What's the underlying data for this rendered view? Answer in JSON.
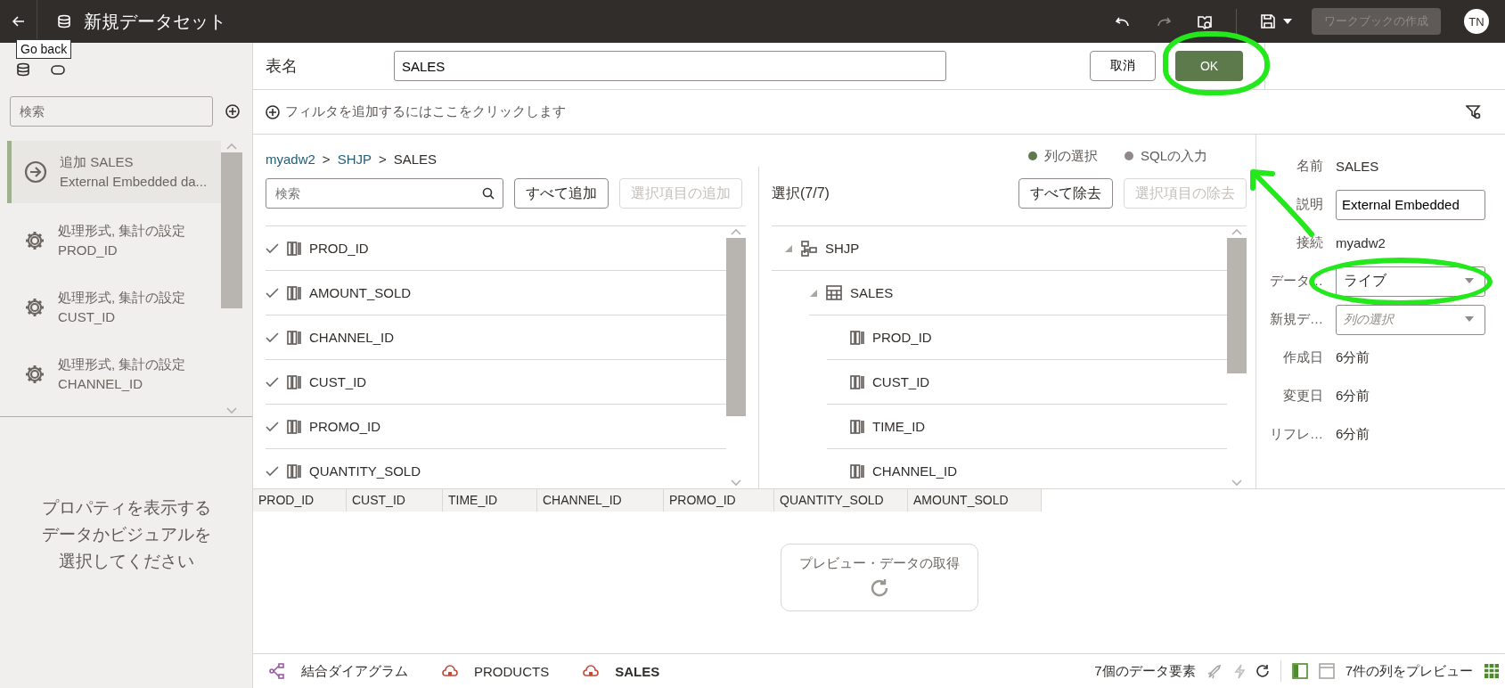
{
  "header": {
    "title": "新規データセット",
    "create_workbook": {
      "label": "ワークブックの作成",
      "disabled": true
    },
    "avatar": "TN"
  },
  "tooltip": "Go back",
  "sidebar": {
    "search": {
      "placeholder": "検索"
    },
    "items": [
      {
        "kind": "add",
        "title": "追加 SALES",
        "subtitle": "External Embedded da...",
        "selected": true
      },
      {
        "kind": "settings",
        "title": "処理形式, 集計の設定",
        "subtitle": "PROD_ID",
        "selected": false
      },
      {
        "kind": "settings",
        "title": "処理形式, 集計の設定",
        "subtitle": "CUST_ID",
        "selected": false
      },
      {
        "kind": "settings",
        "title": "処理形式, 集計の設定",
        "subtitle": "CHANNEL_ID",
        "selected": false
      }
    ],
    "message": "プロパティを表示するデータかビジュアルを選択してください"
  },
  "table_name": {
    "label": "表名",
    "value": "SALES"
  },
  "cancel_button": "取消",
  "ok_button": {
    "label": "OK",
    "annotated": true
  },
  "filter_hint": "フィルタを追加するにはここをクリックします",
  "breadcrumb": {
    "separator": ">",
    "items": [
      {
        "text": "myadw2",
        "link": true
      },
      {
        "text": "SHJP",
        "link": true
      },
      {
        "text": "SALES",
        "link": false
      }
    ]
  },
  "modes": [
    {
      "label": "列の選択",
      "selected": true
    },
    {
      "label": "SQLの入力",
      "selected": false
    }
  ],
  "available": {
    "search": {
      "placeholder": "検索"
    },
    "add_all": "すべて追加",
    "add_selected": {
      "label": "選択項目の追加",
      "disabled": true
    },
    "columns": [
      {
        "name": "PROD_ID",
        "checked": true
      },
      {
        "name": "AMOUNT_SOLD",
        "checked": true
      },
      {
        "name": "CHANNEL_ID",
        "checked": true
      },
      {
        "name": "CUST_ID",
        "checked": true
      },
      {
        "name": "PROMO_ID",
        "checked": true
      },
      {
        "name": "QUANTITY_SOLD",
        "checked": true
      }
    ]
  },
  "selected": {
    "title": "選択(7/7)",
    "remove_all": "すべて除去",
    "remove_selected": {
      "label": "選択項目の除去",
      "disabled": true
    },
    "tree": [
      {
        "kind": "schema",
        "name": "SHJP",
        "expanded": true,
        "children": [
          {
            "kind": "table",
            "name": "SALES",
            "expanded": true,
            "children": [
              {
                "kind": "column",
                "name": "PROD_ID"
              },
              {
                "kind": "column",
                "name": "CUST_ID"
              },
              {
                "kind": "column",
                "name": "TIME_ID"
              },
              {
                "kind": "column",
                "name": "CHANNEL_ID"
              }
            ]
          }
        ]
      }
    ]
  },
  "properties": [
    {
      "kind": "text",
      "label": "名前",
      "value": "SALES"
    },
    {
      "kind": "input",
      "label": "説明",
      "value": "External Embedded"
    },
    {
      "kind": "text",
      "label": "接続",
      "value": "myadw2"
    },
    {
      "kind": "select",
      "label": "データ…",
      "value": "ライブ",
      "annotated": true
    },
    {
      "kind": "select",
      "label": "新規デ…",
      "placeholder": "列の選択"
    },
    {
      "kind": "text",
      "label": "作成日",
      "value": "6分前"
    },
    {
      "kind": "text",
      "label": "変更日",
      "value": "6分前"
    },
    {
      "kind": "text",
      "label": "リフレ…",
      "value": "6分前"
    }
  ],
  "annotation_arrow": true,
  "preview": {
    "columns": [
      "PROD_ID",
      "CUST_ID",
      "TIME_ID",
      "CHANNEL_ID",
      "PROMO_ID",
      "QUANTITY_SOLD",
      "AMOUNT_SOLD"
    ],
    "fetch_button": "プレビュー・データの取得"
  },
  "footer": {
    "tabs": [
      {
        "kind": "diagram",
        "label": "結合ダイアグラム",
        "selected": false
      },
      {
        "kind": "table",
        "label": "PRODUCTS",
        "selected": false
      },
      {
        "kind": "table",
        "label": "SALES",
        "selected": true
      }
    ],
    "element_count": "7個のデータ要素",
    "preview_label": "7件の列をプレビュー"
  }
}
